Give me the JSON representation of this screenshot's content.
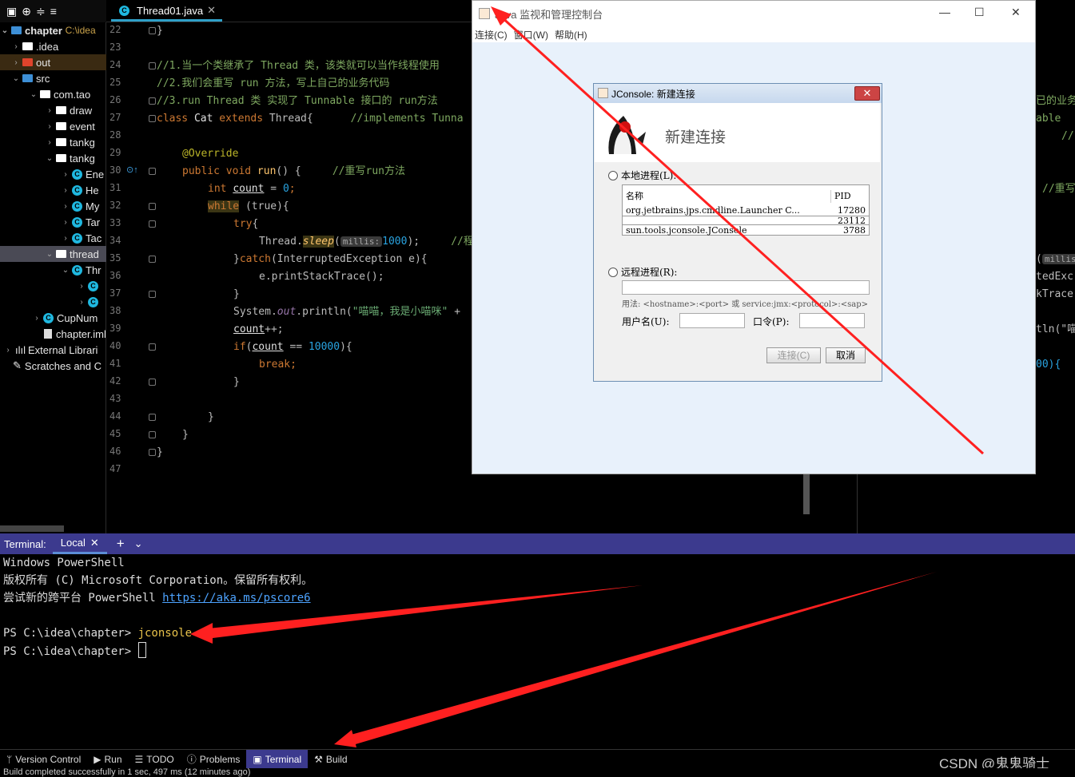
{
  "project": {
    "toolbar_icons": [
      "project-icon",
      "globe-icon",
      "expand-all-icon",
      "collapse-all-icon"
    ],
    "items": [
      {
        "label": "chapter",
        "suffix": "C:\\idea",
        "kind": "module"
      },
      {
        "label": ".idea",
        "kind": "folder"
      },
      {
        "label": "out",
        "kind": "folder-excluded"
      },
      {
        "label": "src",
        "kind": "folder-source"
      },
      {
        "label": "com.tao",
        "kind": "package"
      },
      {
        "label": "draw",
        "kind": "package"
      },
      {
        "label": "event",
        "kind": "package"
      },
      {
        "label": "tankg",
        "kind": "package"
      },
      {
        "label": "tankg",
        "kind": "package"
      },
      {
        "label": "Ene",
        "kind": "class"
      },
      {
        "label": "He",
        "kind": "class"
      },
      {
        "label": "My",
        "kind": "class"
      },
      {
        "label": "Tar",
        "kind": "class"
      },
      {
        "label": "Tac",
        "kind": "class"
      },
      {
        "label": "thread",
        "kind": "package"
      },
      {
        "label": "Thr",
        "kind": "class"
      },
      {
        "label": "",
        "kind": "class"
      },
      {
        "label": "",
        "kind": "class"
      },
      {
        "label": "CupNum",
        "kind": "class"
      },
      {
        "label": "chapter.iml",
        "kind": "file"
      },
      {
        "label": "External Librari",
        "kind": "library"
      },
      {
        "label": "Scratches and C",
        "kind": "scratch"
      }
    ]
  },
  "editor": {
    "tab_label": "Thread01.java",
    "line_numbers": [
      "22",
      "23",
      "24",
      "25",
      "26",
      "27",
      "28",
      "29",
      "30",
      "31",
      "32",
      "33",
      "34",
      "35",
      "36",
      "37",
      "38",
      "39",
      "40",
      "41",
      "42",
      "43",
      "44",
      "45",
      "46",
      "47"
    ],
    "code": {
      "l22": "}",
      "c24": "//1.当一个类继承了 Thread 类，该类就可以当作线程使用",
      "c25": "//2.我们会重写 run 方法，写上自己的业务代码",
      "c26": "//3.run Thread 类 实现了 Tunnable 接口的 run方法",
      "l27_kw1": "class",
      "l27_name": " Cat ",
      "l27_kw2": "extends",
      "l27_rest": " Thread{",
      "l27_cm": "//implements Tunna",
      "l29": "@Override",
      "l30_kw": "public void",
      "l30_fn": " run",
      "l30_rest": "() {",
      "l30_cm": "//重写run方法",
      "l31_kw": "int",
      "l31_var": "count",
      "l31_eq": " = ",
      "l31_num": "0",
      "l31_semi": ";",
      "l32_kw": "while",
      "l32_rest": " (true){",
      "l33_kw": "try",
      "l33_rest": "{",
      "l34_a": "Thread.",
      "l34_fn": "sleep",
      "l34_hint": "millis:",
      "l34_num": "1000",
      "l34_end": ");",
      "l34_cm": "//程",
      "l35_a": "}",
      "l35_kw": "catch",
      "l35_rest": "(InterruptedException e){",
      "l36": "e.printStackTrace();",
      "l37": "}",
      "l38_a": "System.",
      "l38_out": "out",
      "l38_b": ".println(",
      "l38_str": "\"喵喵，我是小喵咪\"",
      "l38_c": " + ",
      "l39_var": "count",
      "l39_rest": "++;",
      "l40_kw": "if",
      "l40_a": "(",
      "l40_var": "count",
      "l40_b": " == ",
      "l40_num": "10000",
      "l40_c": "){",
      "l41": "break;",
      "l42": "}",
      "l44": "}",
      "l45": "}",
      "l46": "}"
    },
    "right_fragments": [
      "已的业务",
      "able",
      "//",
      "//重写",
      "(",
      "millis",
      "tedExc",
      "kTrace",
      "tln(\"喵",
      "00){"
    ]
  },
  "jconsole_window": {
    "title": "Java 监视和管理控制台",
    "menu": [
      "连接(C)",
      "窗口(W)",
      "帮助(H)"
    ],
    "dialog": {
      "title": "JConsole: 新建连接",
      "heading": "新建连接",
      "local_label": "本地进程(L):",
      "table_headers": {
        "name": "名称",
        "pid": "PID"
      },
      "processes": [
        {
          "name": "org.jetbrains.jps.cmdline.Launcher C...",
          "pid": "17280"
        },
        {
          "name": "",
          "pid": "23112"
        },
        {
          "name": "sun.tools.jconsole.JConsole",
          "pid": "3788"
        }
      ],
      "remote_label": "远程进程(R):",
      "usage": "用法: <hostname>:<port> 或 service:jmx:<protocol>:<sap>",
      "username_label": "用户名(U):",
      "password_label": "口令(P):",
      "connect_button": "连接(C)",
      "cancel_button": "取消"
    }
  },
  "terminal": {
    "label": "Terminal:",
    "tab": "Local",
    "lines": {
      "l1": "Windows PowerShell",
      "l2": "版权所有 (C) Microsoft Corporation。保留所有权利。",
      "l3": "尝试新的跨平台 PowerShell ",
      "l3_link": "https://aka.ms/pscore6",
      "prompt1": "PS C:\\idea\\chapter> ",
      "cmd1": "jconsole",
      "prompt2": "PS C:\\idea\\chapter> "
    }
  },
  "tool_windows": [
    {
      "label": "Version Control",
      "icon": "branch-icon"
    },
    {
      "label": "Run",
      "icon": "play-icon"
    },
    {
      "label": "TODO",
      "icon": "list-icon"
    },
    {
      "label": "Problems",
      "icon": "info-icon"
    },
    {
      "label": "Terminal",
      "icon": "terminal-icon",
      "active": true
    },
    {
      "label": "Build",
      "icon": "hammer-icon"
    }
  ],
  "status": "Build completed successfully in 1 sec, 497 ms (12 minutes ago)",
  "watermark": "CSDN @鬼鬼骑士",
  "colors": {
    "accent": "#3c3a8e",
    "arrow": "#ff2020",
    "class_icon": "#1fb8e0"
  }
}
